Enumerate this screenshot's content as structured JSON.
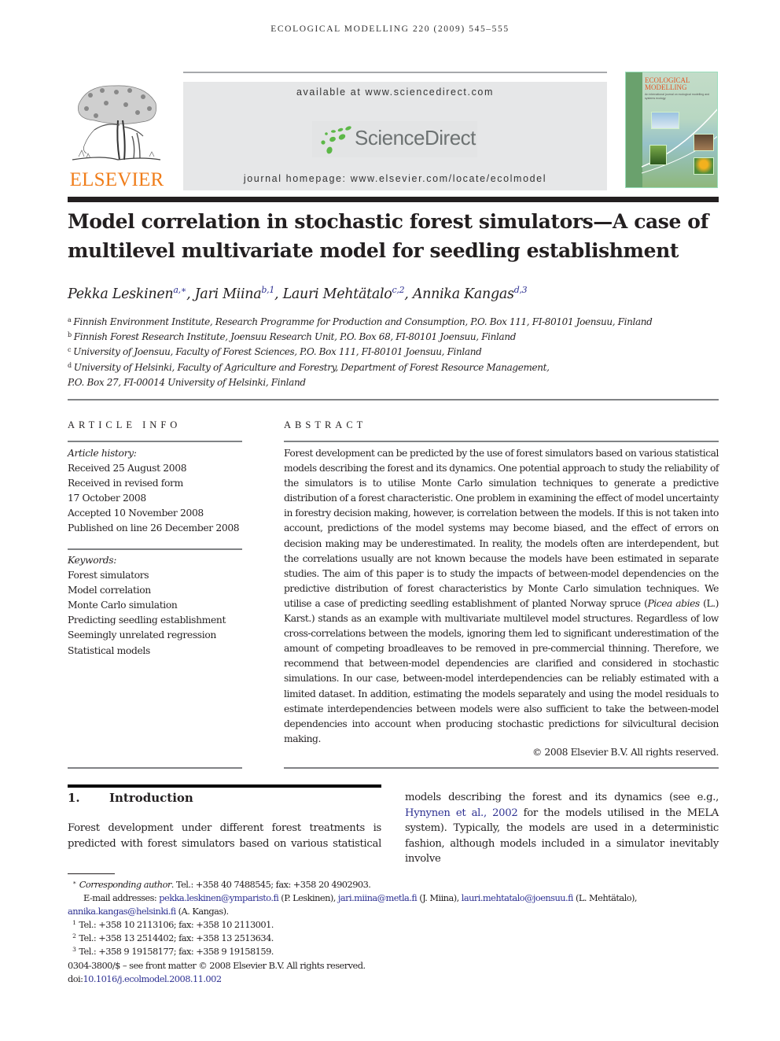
{
  "running_header": "ECOLOGICAL MODELLING 220 (2009) 545–555",
  "masthead": {
    "publisher_logo_text": "ELSEVIER",
    "available_at": "available at www.sciencedirect.com",
    "platform_name": "ScienceDirect",
    "journal_homepage": "journal homepage: www.elsevier.com/locate/ecolmodel",
    "cover": {
      "title_line1": "ECOLOGICAL",
      "title_line2": "MODELLING",
      "subtitle": "An international journal on ecological modelling and systems ecology"
    },
    "colors": {
      "elsevier_orange": "#f07d1a",
      "sciencedirect_green": "#5db848",
      "sciencedirect_gray": "#6d7272",
      "banner_bg": "#e6e7e8",
      "link_blue": "#2e3192"
    }
  },
  "article": {
    "title": "Model correlation in stochastic forest simulators—A case of multilevel multivariate model for seedling establishment",
    "authors": [
      {
        "name": "Pekka Leskinen",
        "marks": "a,∗",
        "sep": ", "
      },
      {
        "name": "Jari Miina",
        "marks": "b,1",
        "sep": ", "
      },
      {
        "name": "Lauri Mehtätalo",
        "marks": "c,2",
        "sep": ", "
      },
      {
        "name": "Annika Kangas",
        "marks": "d,3",
        "sep": ""
      }
    ],
    "affiliations": [
      {
        "mark": "a",
        "text": "Finnish Environment Institute, Research Programme for Production and Consumption, P.O. Box 111, FI-80101 Joensuu, Finland"
      },
      {
        "mark": "b",
        "text": "Finnish Forest Research Institute, Joensuu Research Unit, P.O. Box 68, FI-80101 Joensuu, Finland"
      },
      {
        "mark": "c",
        "text": "University of Joensuu, Faculty of Forest Sciences, P.O. Box 111, FI-80101 Joensuu, Finland"
      },
      {
        "mark": "d",
        "text": "University of Helsinki, Faculty of Agriculture and Forestry, Department of Forest Resource Management,"
      },
      {
        "mark": "",
        "text": "P.O. Box 27, FI-00014 University of Helsinki, Finland"
      }
    ]
  },
  "article_info": {
    "heading": "ARTICLE INFO",
    "history_label": "Article history:",
    "history": [
      "Received 25 August 2008",
      "Received in revised form",
      "17 October 2008",
      "Accepted 10 November 2008",
      "Published on line 26 December 2008"
    ],
    "keywords_label": "Keywords:",
    "keywords": [
      "Forest simulators",
      "Model correlation",
      "Monte Carlo simulation",
      "Predicting seedling establishment",
      "Seemingly unrelated regression",
      "Statistical models"
    ]
  },
  "abstract": {
    "heading": "ABSTRACT",
    "part1": "Forest development can be predicted by the use of forest simulators based on various statistical models describing the forest and its dynamics. One potential approach to study the reliability of the simulators is to utilise Monte Carlo simulation techniques to generate a predictive distribution of a forest characteristic. One problem in examining the effect of model uncertainty in forestry decision making, however, is correlation between the models. If this is not taken into account, predictions of the model systems may become biased, and the effect of errors on decision making may be underestimated. In reality, the models often are interdependent, but the correlations usually are not known because the models have been estimated in separate studies. The aim of this paper is to study the impacts of between-model dependencies on the predictive distribution of forest characteristics by Monte Carlo simulation techniques. We utilise a case of predicting seedling establishment of planted Norway spruce (",
    "species": "Picea abies",
    "part2": " (L.) Karst.) stands as an example with multivariate multilevel model structures. Regardless of low cross-correlations between the models, ignoring them led to significant underestimation of the amount of competing broadleaves to be removed in pre-commercial thinning. Therefore, we recommend that between-model dependencies are clarified and considered in stochastic simulations. In our case, between-model interdependencies can be reliably estimated with a limited dataset. In addition, estimating the models separately and using the model residuals to estimate interdependencies between models were also sufficient to take the between-model dependencies into account when producing stochastic predictions for silvicultural decision making.",
    "copyright": "© 2008 Elsevier B.V. All rights reserved."
  },
  "introduction": {
    "number": "1.",
    "title": "Introduction",
    "left_text": "Forest development under different forest treatments is predicted with forest simulators based on various statistical",
    "right_text_1": "models describing the forest and its dynamics (see e.g., ",
    "right_citation": "Hynynen et al., 2002",
    "right_text_2": " for the models utilised in the MELA system). Typically, the models are used in a deterministic fashion, although models included in a simulator inevitably involve"
  },
  "footnotes": {
    "corresponding_mark": "∗",
    "corresponding_label": "Corresponding author",
    "corresponding_contact": ". Tel.: +358 40 7488545; fax: +358 20 4902903.",
    "email_label": "E-mail addresses: ",
    "emails": [
      {
        "address": "pekka.leskinen@ymparisto.fi",
        "owner": " (P. Leskinen), "
      },
      {
        "address": "jari.miina@metla.fi",
        "owner": " (J. Miina), "
      },
      {
        "address": "lauri.mehtatalo@joensuu.fi",
        "owner": " (L. Mehtätalo),"
      },
      {
        "address": "annika.kangas@helsinki.fi",
        "owner": " (A. Kangas)."
      }
    ],
    "notes": [
      {
        "mark": "1",
        "text": "Tel.: +358 10 2113106; fax: +358 10 2113001."
      },
      {
        "mark": "2",
        "text": "Tel.: +358 13 2514402; fax: +358 13 2513634."
      },
      {
        "mark": "3",
        "text": "Tel.: +358 9 19158177; fax: +358 9 19158159."
      }
    ],
    "issn_line": "0304-3800/$ – see front matter © 2008 Elsevier B.V. All rights reserved.",
    "doi_label": "doi:",
    "doi": "10.1016/j.ecolmodel.2008.11.002"
  }
}
